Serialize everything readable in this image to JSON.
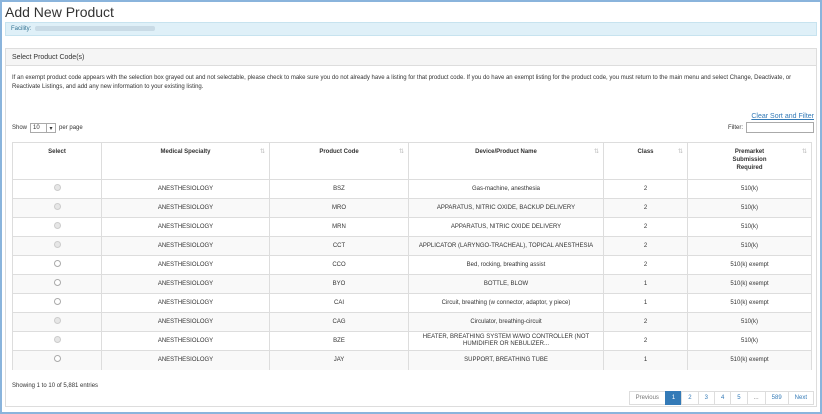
{
  "page": {
    "title": "Add New Product",
    "facility_label": "Facility:"
  },
  "panel": {
    "heading": "Select Product Code(s)",
    "notice": "If an exempt product code appears with the selection box grayed out and not selectable, please check to make sure you do not already have a listing for that product code. If you do have an exempt listing for the product code, you must return to the main menu and select Change, Deactivate, or Reactivate Listings, and add any new information to your existing listing."
  },
  "controls": {
    "clear_sort_filter": "Clear Sort and Filter",
    "show_label": "Show",
    "per_page_value": "10",
    "per_page_label": "per page",
    "filter_label": "Filter:",
    "filter_value": ""
  },
  "table": {
    "headers": [
      "Select",
      "Medical Specialty",
      "Product Code",
      "Device/Product Name",
      "Class",
      "Premarket Submission Required"
    ],
    "rows": [
      {
        "selectable": false,
        "specialty": "ANESTHESIOLOGY",
        "code": "BSZ",
        "name": "Gas-machine, anesthesia",
        "class": "2",
        "premarket": "510(k)"
      },
      {
        "selectable": false,
        "specialty": "ANESTHESIOLOGY",
        "code": "MRO",
        "name": "APPARATUS, NITRIC OXIDE, BACKUP DELIVERY",
        "class": "2",
        "premarket": "510(k)"
      },
      {
        "selectable": false,
        "specialty": "ANESTHESIOLOGY",
        "code": "MRN",
        "name": "APPARATUS, NITRIC OXIDE DELIVERY",
        "class": "2",
        "premarket": "510(k)"
      },
      {
        "selectable": false,
        "specialty": "ANESTHESIOLOGY",
        "code": "CCT",
        "name": "APPLICATOR (LARYNGO-TRACHEAL), TOPICAL ANESTHESIA",
        "class": "2",
        "premarket": "510(k)"
      },
      {
        "selectable": true,
        "specialty": "ANESTHESIOLOGY",
        "code": "CCO",
        "name": "Bed, rocking, breathing assist",
        "class": "2",
        "premarket": "510(k) exempt"
      },
      {
        "selectable": true,
        "specialty": "ANESTHESIOLOGY",
        "code": "BYO",
        "name": "BOTTLE, BLOW",
        "class": "1",
        "premarket": "510(k) exempt"
      },
      {
        "selectable": true,
        "specialty": "ANESTHESIOLOGY",
        "code": "CAI",
        "name": "Circuit, breathing (w connector, adaptor, y piece)",
        "class": "1",
        "premarket": "510(k) exempt"
      },
      {
        "selectable": false,
        "specialty": "ANESTHESIOLOGY",
        "code": "CAG",
        "name": "Circulator, breathing-circuit",
        "class": "2",
        "premarket": "510(k)"
      },
      {
        "selectable": false,
        "specialty": "ANESTHESIOLOGY",
        "code": "BZE",
        "name": "HEATER, BREATHING SYSTEM W/WO CONTROLLER (NOT HUMIDIFIER OR NEBULIZER...",
        "class": "2",
        "premarket": "510(k)"
      },
      {
        "selectable": true,
        "specialty": "ANESTHESIOLOGY",
        "code": "JAY",
        "name": "SUPPORT, BREATHING TUBE",
        "class": "1",
        "premarket": "510(k) exempt"
      }
    ]
  },
  "footer": {
    "info": "Showing 1 to 10 of 5,881 entries",
    "pages": [
      "Previous",
      "1",
      "2",
      "3",
      "4",
      "5",
      "...",
      "589",
      "Next"
    ],
    "active_page": "1"
  },
  "colors": {
    "accent": "#337ab7",
    "facility_bg": "#dff0f8",
    "frame": "#8ab4dc"
  }
}
